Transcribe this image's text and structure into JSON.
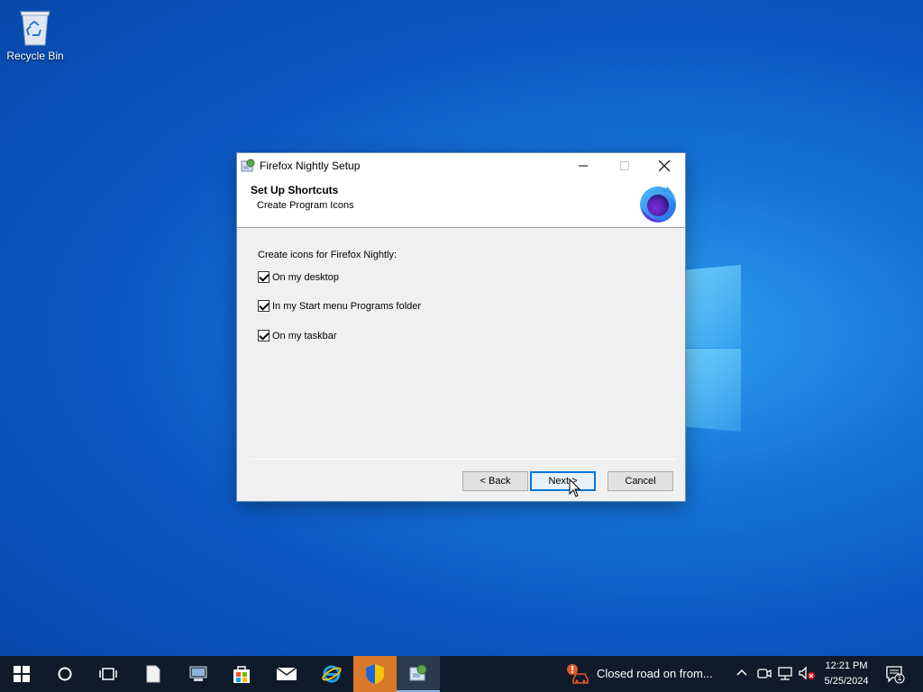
{
  "desktop": {
    "icons": [
      {
        "label": "Recycle Bin",
        "icon": "recycle-bin-icon"
      }
    ]
  },
  "dialog": {
    "title": "Firefox Nightly Setup",
    "header": {
      "title": "Set Up Shortcuts",
      "subtitle": "Create Program Icons",
      "logo": "firefox-nightly-logo"
    },
    "prompt": "Create icons for Firefox Nightly:",
    "options": [
      {
        "label": "On my desktop",
        "checked": true
      },
      {
        "label": "In my Start menu Programs folder",
        "checked": true
      },
      {
        "label": "On my taskbar",
        "checked": true
      }
    ],
    "buttons": {
      "back": "< Back",
      "next": "Next >",
      "cancel": "Cancel"
    }
  },
  "taskbar": {
    "items": [
      {
        "name": "start-button",
        "icon": "windows-start-icon"
      },
      {
        "name": "search-button",
        "icon": "cortana-circle-icon"
      },
      {
        "name": "task-view-button",
        "icon": "task-view-icon"
      },
      {
        "name": "notepad-app",
        "icon": "document-icon"
      },
      {
        "name": "computer-app",
        "icon": "computer-icon"
      },
      {
        "name": "store-app",
        "icon": "store-bag-icon"
      },
      {
        "name": "mail-app",
        "icon": "mail-icon"
      },
      {
        "name": "internet-explorer-app",
        "icon": "ie-icon"
      },
      {
        "name": "uac-shield-app",
        "icon": "shield-icon"
      },
      {
        "name": "setup-app",
        "icon": "setup-icon"
      }
    ],
    "notification": "Closed road on from...",
    "clock": {
      "time": "12:21 PM",
      "date": "5/25/2024"
    },
    "action_center_badge": "1"
  }
}
